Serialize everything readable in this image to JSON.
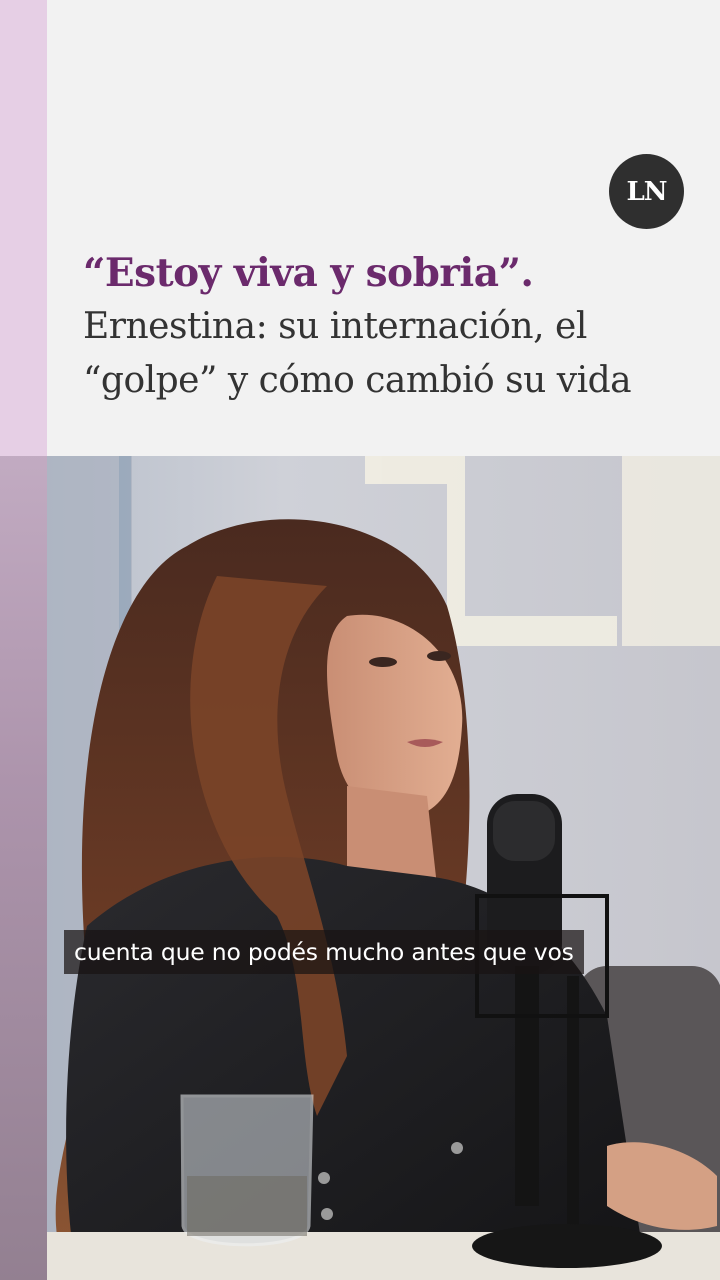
{
  "brand": {
    "logo_text": "LN",
    "accent_color": "#6b2a6c",
    "bar_color": "#e6cfe5"
  },
  "headline": {
    "lead": "“Estoy viva y sobria”.",
    "sub_line_1": "Ernestina: su internación, el",
    "sub_line_2": "“golpe” y cómo cambió su vida"
  },
  "video": {
    "caption": "cuenta que no podés mucho antes que vos",
    "scene": {
      "icons": [
        "microphone-icon",
        "water-glass-icon"
      ]
    }
  }
}
